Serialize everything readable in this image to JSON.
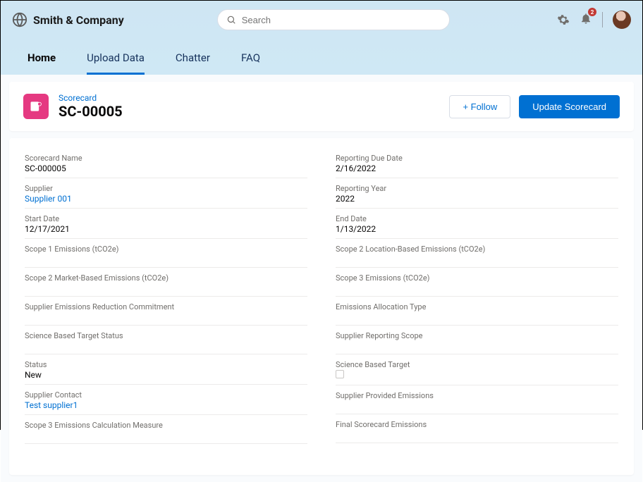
{
  "brand": {
    "name": "Smith & Company"
  },
  "search": {
    "placeholder": "Search"
  },
  "notifications": {
    "count": "2"
  },
  "nav": {
    "items": [
      {
        "label": "Home"
      },
      {
        "label": "Upload Data"
      },
      {
        "label": "Chatter"
      },
      {
        "label": "FAQ"
      }
    ]
  },
  "record": {
    "object_label": "Scorecard",
    "name": "SC-00005",
    "follow_label": "+ Follow",
    "update_label": "Update Scorecard"
  },
  "fields": {
    "left": [
      {
        "label": "Scorecard Name",
        "value": "SC-000005",
        "link": false
      },
      {
        "label": "Supplier",
        "value": "Supplier 001",
        "link": true
      },
      {
        "label": "Start Date",
        "value": "12/17/2021",
        "link": false
      },
      {
        "label": "Scope 1 Emissions (tCO2e)",
        "value": "",
        "link": false
      },
      {
        "label": "Scope 2 Market-Based Emissions (tCO2e)",
        "value": "",
        "link": false
      },
      {
        "label": "Supplier Emissions Reduction Commitment",
        "value": "",
        "link": false
      },
      {
        "label": "Science Based Target Status",
        "value": "",
        "link": false
      },
      {
        "label": "Status",
        "value": "New",
        "link": false
      },
      {
        "label": "Supplier Contact",
        "value": "Test supplier1",
        "link": true
      },
      {
        "label": "Scope 3 Emissions Calculation Measure",
        "value": "",
        "link": false
      }
    ],
    "right": [
      {
        "label": "Reporting Due Date",
        "value": "2/16/2022",
        "link": false
      },
      {
        "label": "Reporting Year",
        "value": "2022",
        "link": false
      },
      {
        "label": "End Date",
        "value": "1/13/2022",
        "link": false
      },
      {
        "label": "Scope 2 Location-Based Emissions (tCO2e)",
        "value": "",
        "link": false
      },
      {
        "label": "Scope 3 Emissions (tCO2e)",
        "value": "",
        "link": false
      },
      {
        "label": "Emissions Allocation Type",
        "value": "",
        "link": false
      },
      {
        "label": "Supplier Reporting Scope",
        "value": "",
        "link": false
      },
      {
        "label": "Science Based Target",
        "value": "",
        "checkbox": true
      },
      {
        "label": "Supplier Provided Emissions",
        "value": "",
        "link": false
      },
      {
        "label": "Final Scorecard Emissions",
        "value": "",
        "link": false
      }
    ]
  }
}
